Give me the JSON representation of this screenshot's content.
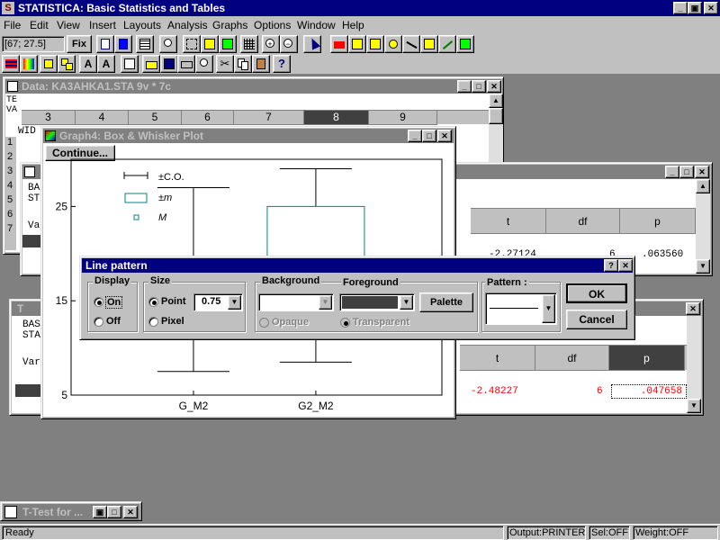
{
  "app": {
    "title": "STATISTICA: Basic Statistics and Tables",
    "logo": "S",
    "window_controls": [
      "_",
      "▣",
      "✕"
    ]
  },
  "menu": [
    "File",
    "Edit",
    "View",
    "Insert",
    "Layouts",
    "Analysis",
    "Graphs",
    "Options",
    "Window",
    "Help"
  ],
  "toolbar": {
    "coords": "[67; 27.5]",
    "fix_label": "Fix",
    "help_label": "?"
  },
  "data_window": {
    "title": "Data: KA3AHKA1.STA 9v * 7c",
    "left_partial": [
      "TE",
      "VA"
    ],
    "columns": [
      "3",
      "4",
      "5",
      "6",
      "7",
      "8",
      "9"
    ],
    "row_label_partial": "WID",
    "row_numbers": [
      "1",
      "2",
      "3",
      "4",
      "5",
      "6",
      "7"
    ]
  },
  "ttest_window_1": {
    "left_lines": [
      "BA",
      "ST",
      "",
      "Va"
    ],
    "headers": [
      "t",
      "df",
      "p"
    ],
    "values": [
      "-2.27124",
      "6",
      ".063560"
    ]
  },
  "ttest_window_2": {
    "title_partial": "T",
    "left_lines": [
      "BAS",
      "STA",
      "",
      "Var"
    ],
    "headers": [
      "t",
      "df",
      "p"
    ],
    "values": [
      "-2.48227",
      "6",
      ".047658"
    ]
  },
  "graph_window": {
    "title": "Graph4: Box & Whisker Plot",
    "continue_label": "Continue...",
    "legend": [
      "±C.O.",
      "±m",
      "M"
    ]
  },
  "chart_data": {
    "type": "box",
    "categories": [
      "G_M2",
      "G2_M2"
    ],
    "y_ticks": [
      5,
      15,
      25
    ],
    "ylim": [
      5,
      30
    ],
    "series": [
      {
        "whisker_low": 7.5,
        "box_low": 11.5,
        "box_high": 19.5,
        "whisker_high": 27
      },
      {
        "whisker_low": 8.5,
        "box_low": 14,
        "box_high": 25,
        "whisker_high": 29
      }
    ]
  },
  "dialog": {
    "title": "Line pattern",
    "help_btn": "?",
    "close_btn": "✕",
    "display_label": "Display",
    "on_label": "On",
    "off_label": "Off",
    "size_label": "Size",
    "point_label": "Point",
    "pixel_label": "Pixel",
    "size_value": "0.75",
    "background_label": "Background",
    "foreground_label": "Foreground",
    "palette_label": "Palette",
    "opaque_label": "Opaque",
    "transparent_label": "Transparent",
    "pattern_label": "Pattern :",
    "ok_label": "OK",
    "cancel_label": "Cancel"
  },
  "minimized": {
    "title": "T-Test for ..."
  },
  "status": {
    "text": "Ready",
    "output": "Output:PRINTER",
    "sel": "Sel:OFF",
    "weight": "Weight:OFF"
  },
  "colors": {
    "title_active": "#000080",
    "title_inactive": "#808080",
    "face": "#c0c0c0",
    "desktop": "#808080",
    "error_red": "#ff0000"
  }
}
